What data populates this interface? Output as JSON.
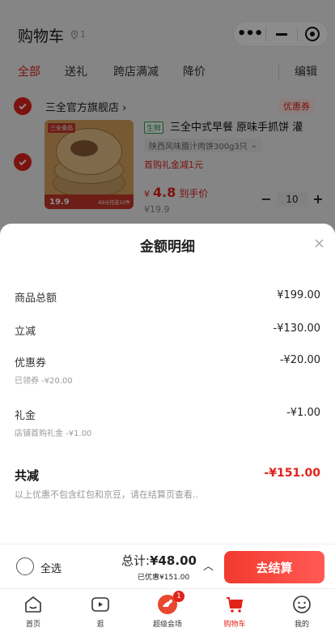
{
  "header": {
    "title": "购物车",
    "location_count": "1",
    "tabs": [
      "全部",
      "送礼",
      "跨店满减",
      "降价"
    ],
    "edit_label": "编辑"
  },
  "store": {
    "name": "三全官方旗舰店 ›",
    "coupon_tag": "优惠券"
  },
  "product": {
    "fresh_tag": "生鲜",
    "title": "三全中式早餐 原味手抓饼 灌",
    "spec": "陕西风味腊汁肉饼300g3只",
    "promo": "首购礼金减1元",
    "price_currency": "¥",
    "price_value": "4.8",
    "price_note": "到手价",
    "original_price": "¥19.9",
    "quantity": "10",
    "image_brand": "三全食品",
    "image_strip_price": "19.9",
    "image_strip_note": "69元任选10件"
  },
  "sheet": {
    "title": "金额明细",
    "close_symbol": "×",
    "rows": [
      {
        "label": "商品总额",
        "value": "¥199.00",
        "sub": ""
      },
      {
        "label": "立减",
        "value": "-¥130.00",
        "sub": ""
      },
      {
        "label": "优惠券",
        "value": "-¥20.00",
        "sub": "已领券 -¥20.00"
      },
      {
        "label": "礼金",
        "value": "-¥1.00",
        "sub": "店铺首购礼金 -¥1.00"
      }
    ],
    "total_label": "共减",
    "total_value": "-¥151.00",
    "note": "以上优惠不包含红包和京豆，请在结算页查看.."
  },
  "bottom_bar": {
    "select_all": "全选",
    "total_prefix": "总计:",
    "total_value": "¥48.00",
    "saved": "已优惠¥151.00",
    "caret": "︿",
    "checkout": "去结算"
  },
  "nav": {
    "items": [
      {
        "label": "首页",
        "icon": "home-icon"
      },
      {
        "label": "逛",
        "icon": "video-icon"
      },
      {
        "label": "超级会场",
        "icon": "venue-icon",
        "badge": "1"
      },
      {
        "label": "购物车",
        "icon": "cart-icon"
      },
      {
        "label": "我的",
        "icon": "profile-icon"
      }
    ],
    "active_index": 3
  },
  "colors": {
    "accent": "#e2231a",
    "fresh": "#2aa24a"
  }
}
